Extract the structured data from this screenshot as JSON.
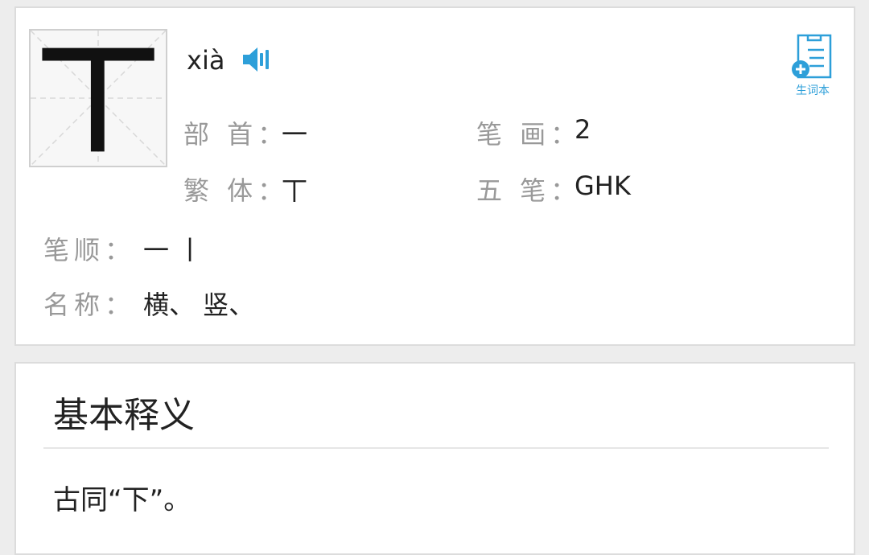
{
  "character": "丅",
  "pinyin": "xià",
  "vocab_button_label": "生词本",
  "info": {
    "radical_label": "部 首：",
    "radical_value": "一",
    "strokes_label": "笔 画：",
    "strokes_value": "2",
    "traditional_label": "繁 体：",
    "traditional_value": "丅",
    "wubi_label": "五 笔：",
    "wubi_value": "GHK"
  },
  "stroke_order_label": "笔顺：",
  "stroke_order_value": "一 丨",
  "stroke_names_label": "名称：",
  "stroke_names_value": "横、 竖、",
  "basic_meaning": {
    "title": "基本释义",
    "definition": "古同“下”。"
  },
  "colors": {
    "accent": "#2d9fd9",
    "label": "#999999",
    "text": "#222222"
  },
  "icons": {
    "audio": "speaker-icon",
    "vocab": "add-to-vocab-icon"
  }
}
